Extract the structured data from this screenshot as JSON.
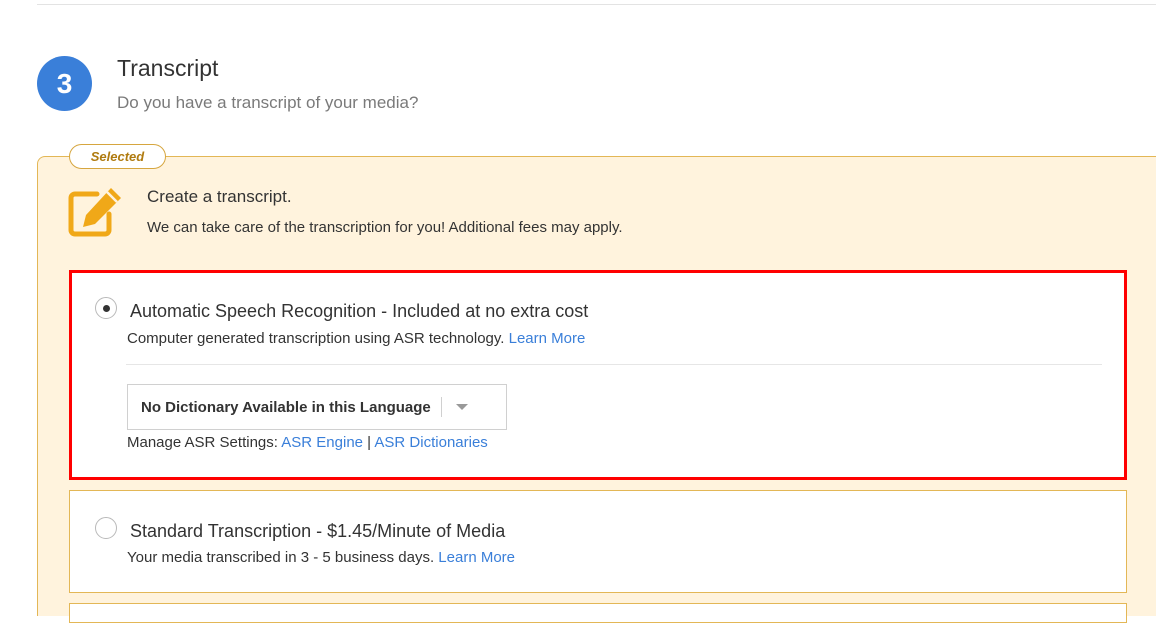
{
  "step": {
    "number": "3",
    "title": "Transcript",
    "subtitle": "Do you have a transcript of your media?"
  },
  "panel": {
    "selected_badge": "Selected",
    "icon": "edit-icon",
    "title": "Create a transcript.",
    "description": "We can take care of the transcription for you! Additional fees may apply."
  },
  "options": {
    "asr": {
      "selected": true,
      "title": "Automatic Speech Recognition - Included at no extra cost",
      "description": "Computer generated transcription using ASR technology.",
      "learn_more": "Learn More",
      "dictionary_select": "No Dictionary Available in this Language",
      "manage_label": "Manage ASR Settings:",
      "engine_link": "ASR Engine",
      "separator": "|",
      "dictionaries_link": "ASR Dictionaries"
    },
    "standard": {
      "selected": false,
      "title": "Standard Transcription - $1.45/Minute of Media",
      "description": "Your media transcribed in 3 - 5 business days.",
      "learn_more": "Learn More"
    }
  },
  "colors": {
    "accent": "#3a7fd9",
    "panel_bg": "#fff3dd",
    "panel_border": "#e3b756",
    "icon": "#f0a818",
    "highlight": "#ff0000"
  }
}
